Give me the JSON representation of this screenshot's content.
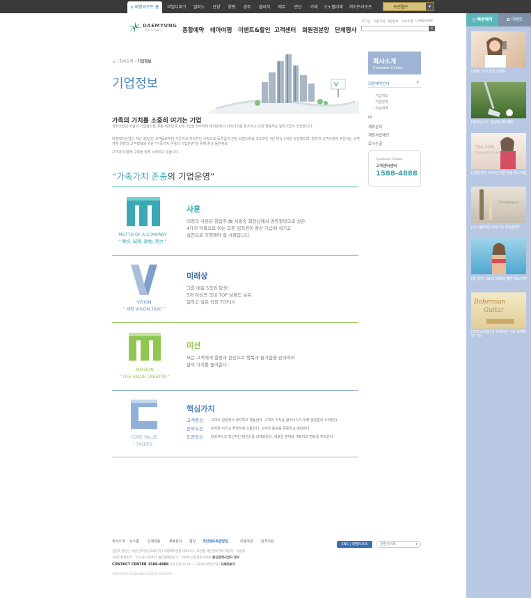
{
  "top_nav": {
    "items": [
      "대명리조트 홈",
      "비발디파크",
      "델피노",
      "단양",
      "양평",
      "경주",
      "쏠비치",
      "제주",
      "변산",
      "거제",
      "소노펠리체",
      "게이트리조트"
    ],
    "destination_select": "오션월드"
  },
  "header": {
    "logo_text": "DAEMYUNG",
    "logo_sub": "RESORT",
    "nav": [
      "종합예약",
      "테마여행",
      "이벤트&할인",
      "고객센터",
      "회원권분양",
      "단체행사"
    ],
    "utility": [
      "로그인",
      "회원가입",
      "회원정보",
      "사이트맵",
      "LANGUAGE"
    ]
  },
  "breadcrumb": [
    "회사소개",
    "기업정보"
  ],
  "page_title": "기업정보",
  "intro": {
    "heading": "가족의 가치를 소중히 여기는 기업",
    "para1": "개척어었던 막광과 기업정신을 갖춘 레저업계 선두기업을 자부하며 레저문화의 미래가치를 창조하고 또한 행동하는 일류기업이 되겠습니다.",
    "para2": "대명레저산업은 지난 20년간 고객들로부터 꾸준하고 지속적인 사랑으로 등중업의 선정 브랜드파워 조도부문 4년 연속 1위를 달성했으며, 철저히 고객사랑에 부응하는 고객지향 경영과 고객행복을 위한 \"가족가치 존중의 기업운영\"을 위해 항상 동반자로",
    "para3": "고객과의 함께 구축을 위해 노력하고 있습니다."
  },
  "management_heading": {
    "pre": "“",
    "highlight": "가족가치 존중",
    "post": "의 기업운영”"
  },
  "sections": [
    {
      "title": "사훈",
      "label": "MOTTO OF A COMPANY",
      "sub": "“ 親切, 誠實, 勤勉, 努力 ”",
      "lines": [
        "대명의 사훈은 창업주 故 서홍송 회장님께서 경영철학으로 삼은",
        "4가지 덕목으로 이는 모든 임직원이 항상 가슴에 새기고",
        "실천으로 이행해야 할 사항입니다."
      ]
    },
    {
      "title": "미래상",
      "label": "VISION",
      "sub": "“ 대명 VISION 2020 ”",
      "lines": [
        "그룹 매출 5조원 달성!",
        "5개 이상의 국내 TOP 브랜드 보유",
        "일하고 싶은 직장 TOP10"
      ]
    },
    {
      "title": "미션",
      "label": "MISSION",
      "sub": "“ LIFE VALUE CREATOR ”",
      "lines": [
        "모든 고객에게 열정과 헌신으로 행복과 즐거움을 선사하여",
        "삶의 가치를 높여준다."
      ]
    },
    {
      "title": "핵심가치",
      "label": "CORE VALUE",
      "sub": "“ 3VLUES ”",
      "values": [
        {
          "name": "고객중심",
          "desc": "고객의 입장에서 생각하고 행동한다. 고객의 가치를 끌어나가기 위해 끊임없이 노력한다."
        },
        {
          "name": "신뢰우선",
          "desc": "원칙을 지키고 투명하게 소통한다. 고객과 동료를 존중하고 배려한다."
        },
        {
          "name": "도전정신",
          "desc": "창조적이고 혁신적인 마인드를 내재화한다. 새로운 분야를 개척하고 변화를 주도한다."
        }
      ]
    }
  ],
  "sidebar": {
    "title": "회사소개",
    "subtitle": "Customer Center",
    "menu_head": "회원혜택안내",
    "sub_items": [
      "기업개요",
      "기업연혁",
      "수상내역"
    ],
    "links": [
      "IR",
      "제휴문의",
      "계량사업제안",
      "오시는길"
    ],
    "contact_label_en": "Customer Center",
    "contact_label": "고객센터센터",
    "contact_phone": "1588-4888"
  },
  "right_panel": {
    "tab_quick": "빠른예약",
    "tab_event": "이벤트",
    "promos": [
      "[양평] 조기 학실 이벤트",
      "[델피노] CC 골린팀 헤이팬트",
      "[양평]개관 20주년기념 이용 패스이벤",
      "[소노펠리체] 선택가치 하이클래스",
      "[쏠 비치] 2012 대명의 해변 패스이벤",
      "[델피노/비발디] 보헤미안 기타 보헤미안 기타"
    ]
  },
  "footer": {
    "links": [
      "회사소개",
      "뉴스룸",
      "인재채용",
      "제휴문의",
      "협찬",
      "개인정보취급방침",
      "이용약관",
      "원격지원"
    ],
    "sns_label": "SNS | 대명리조트",
    "family_site": "관련사이트",
    "info_line1": "강원도 홍천군 서면 한치골길 262 (주) 대명레저산업  대표이사 : 조현철   개인정보관리 책임자 : 유용혁",
    "info_line2": "사업자등록번호 : 223-81-06041   통신판매업신고 : 2006-강원홍천-0008",
    "biz_info_label": "통신판매사업자 정보",
    "contact_center": "CONTACT CENTER 1588-4888",
    "contact_hours": "운영시간 07:00 ~ 23:00 (연중무휴)",
    "mark_label": "자세히보기",
    "copyright": "COPYRIGHT DAEMYUNG LEISURE INDUSTRY"
  },
  "colors": {
    "teal": "#3aa9b3",
    "blue": "#5b87bf",
    "green": "#8fc751",
    "navy": "#4a8ac2"
  }
}
